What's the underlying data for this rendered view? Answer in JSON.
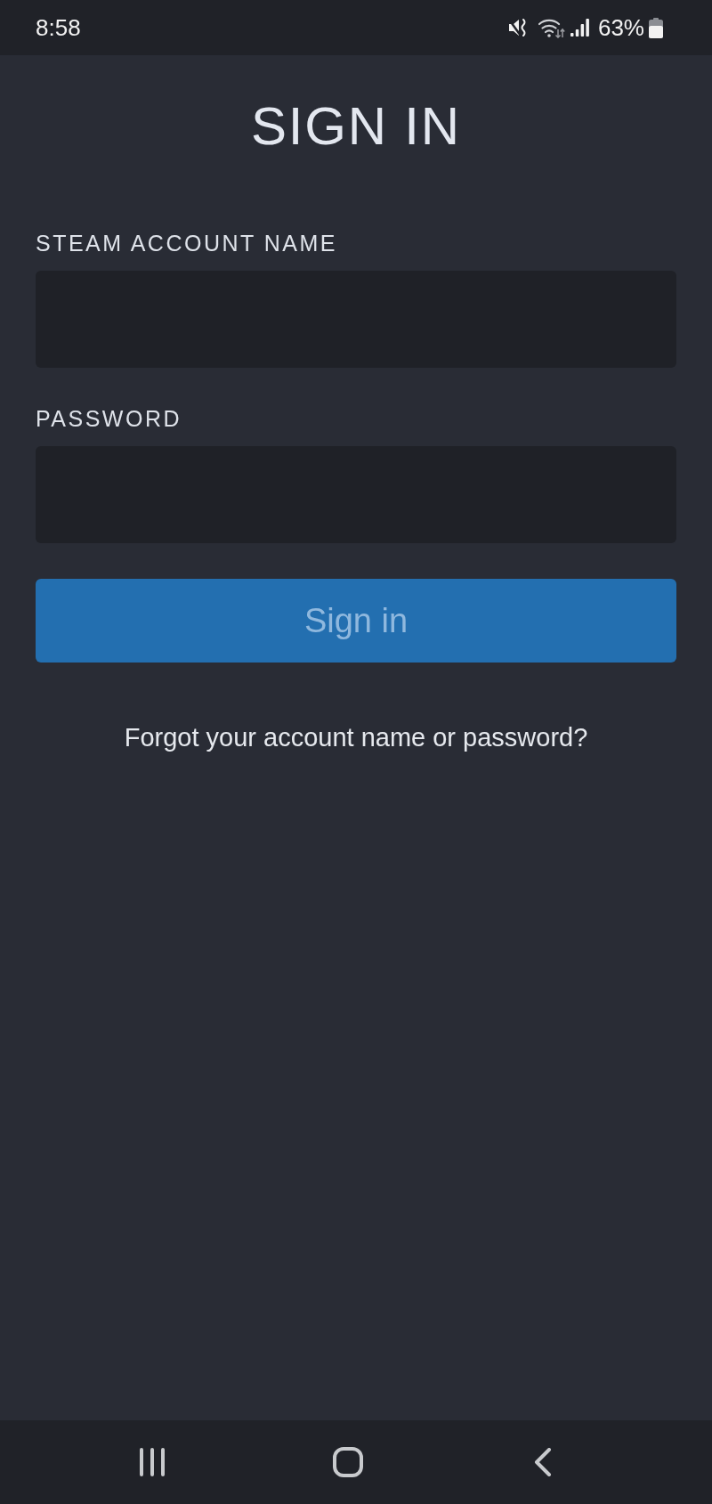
{
  "status_bar": {
    "time": "8:58",
    "battery": "63%"
  },
  "title": "SIGN IN",
  "fields": [
    {
      "label": "STEAM ACCOUNT NAME"
    },
    {
      "label": "PASSWORD"
    }
  ],
  "sign_in_button": {
    "label": "Sign in",
    "disabled": true
  },
  "forgot_link": "Forgot your account name or password?"
}
